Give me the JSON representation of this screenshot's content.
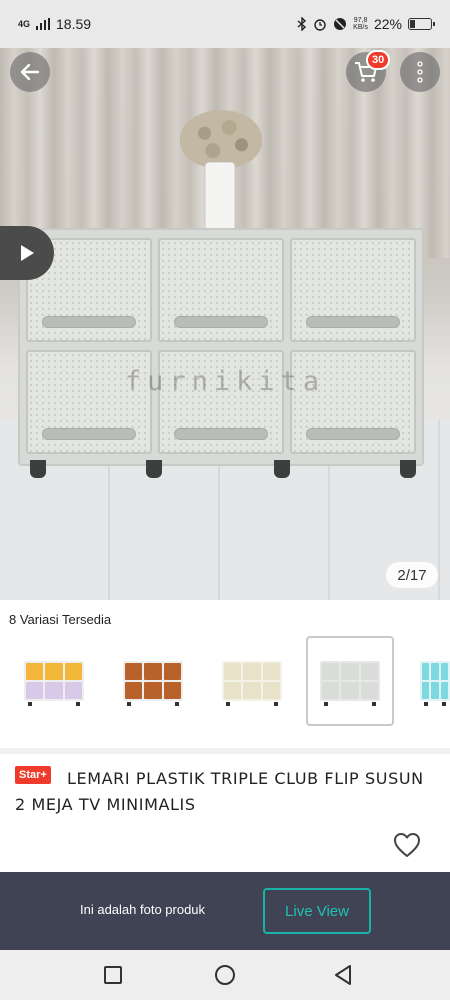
{
  "status_bar": {
    "network": "4G",
    "time": "18.59",
    "speed_value": "97,8",
    "speed_unit": "KB/s",
    "battery": "22%",
    "battery_level": 0.22
  },
  "hero": {
    "watermark": "furnikita",
    "image_counter": "2/17",
    "cart_count": "30"
  },
  "variants": {
    "title": "8 Variasi Tersedia",
    "items": [
      {
        "name": "variant-yellow-purple",
        "colors": [
          "#f2b73a",
          "#d9c8e8"
        ]
      },
      {
        "name": "variant-brown",
        "colors": [
          "#b8612a",
          "#b8612a"
        ]
      },
      {
        "name": "variant-cream",
        "colors": [
          "#e8e3c8",
          "#e8e3c8"
        ]
      },
      {
        "name": "variant-grey",
        "colors": [
          "#d9dcd8",
          "#d9dcd8"
        ],
        "selected": true
      },
      {
        "name": "variant-aqua",
        "colors": [
          "#7ed8e0",
          "#7ed8e0"
        ]
      }
    ]
  },
  "product": {
    "badge": "Star+",
    "title": "LEMARI PLASTIK TRIPLE CLUB FLIP SUSUN 2 MEJA TV MINIMALIS"
  },
  "bottom_bar": {
    "hint": "Ini adalah foto produk",
    "live_button": "Live View"
  },
  "colors": {
    "accent_red": "#ee3b2b",
    "teal": "#19b3a6",
    "bar_dark": "#3f4354"
  },
  "icons": [
    "back-arrow-icon",
    "cart-icon",
    "more-vertical-icon",
    "play-icon",
    "heart-icon",
    "square-icon",
    "circle-icon",
    "triangle-icon"
  ]
}
